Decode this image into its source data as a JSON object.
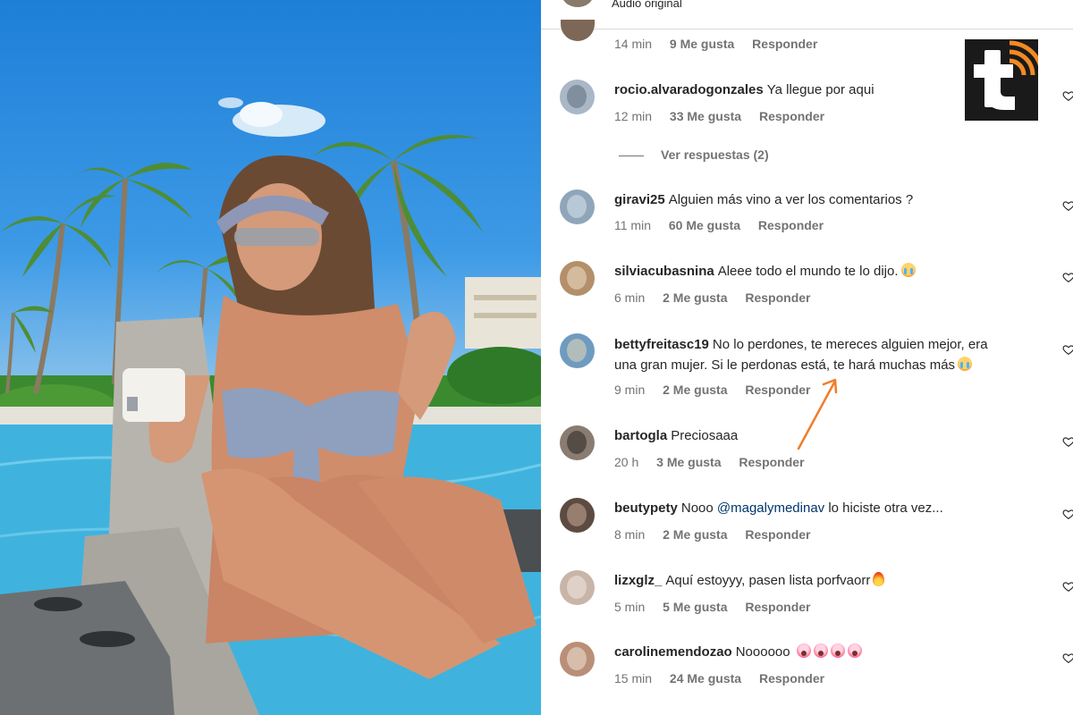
{
  "top": {
    "audio_label": "Audio original",
    "first_meta": {
      "time": "14 min",
      "likes": "9 Me gusta",
      "reply": "Responder"
    }
  },
  "comments": [
    {
      "username": "rocio.alvaradogonzales",
      "text": "Ya llegue por aqui",
      "time": "12 min",
      "likes": "33 Me gusta",
      "reply": "Responder",
      "avatar_color": "#a9b7c6"
    },
    {
      "username": "giravi25",
      "text": "Alguien más vino a ver los comentarios ?",
      "time": "11 min",
      "likes": "60 Me gusta",
      "reply": "Responder",
      "avatar_color": "#8fa6ba"
    },
    {
      "username": "silviacubasnina",
      "text": "Aleee todo el mundo te lo dijo.",
      "time": "6 min",
      "likes": "2 Me gusta",
      "reply": "Responder",
      "avatar_color": "#b38f6a",
      "emoji": "cry"
    },
    {
      "username": "bettyfreitasc19",
      "text_line1": "No lo perdones, te mereces alguien mejor, era",
      "text_line2": "una gran mujer. Si le perdonas está, te hará muchas más",
      "time": "9 min",
      "likes": "2 Me gusta",
      "reply": "Responder",
      "avatar_color": "#6f9bc0",
      "emoji": "cry"
    },
    {
      "username": "bartogla",
      "text": "Preciosaaa",
      "time": "20 h",
      "likes": "3 Me gusta",
      "reply": "Responder",
      "avatar_color": "#8a7c70"
    },
    {
      "username": "beutypety",
      "text_before": "Nooo",
      "mention": "@magalymedinav",
      "text_after": "lo hiciste otra vez...",
      "time": "8 min",
      "likes": "2 Me gusta",
      "reply": "Responder",
      "avatar_color": "#5d4b42"
    },
    {
      "username": "lizxglz_",
      "text": "Aquí estoyyy, pasen lista porfvaorr",
      "time": "5 min",
      "likes": "5 Me gusta",
      "reply": "Responder",
      "avatar_color": "#c9b5a8",
      "emoji": "fire"
    },
    {
      "username": "carolinemendozao",
      "text": "Noooooo",
      "time": "15 min",
      "likes": "24 Me gusta",
      "reply": "Responder",
      "avatar_color": "#b98f78",
      "emoji": "scream"
    }
  ],
  "replies_toggle": "Ver respuestas (2)",
  "colors": {
    "meta_gray": "#737373",
    "mention_blue": "#00376b",
    "arrow_orange": "#f07d2a",
    "logo_orange": "#f28a23"
  },
  "icons": {
    "like": "heart-icon",
    "logo": "brand-logo-t"
  }
}
